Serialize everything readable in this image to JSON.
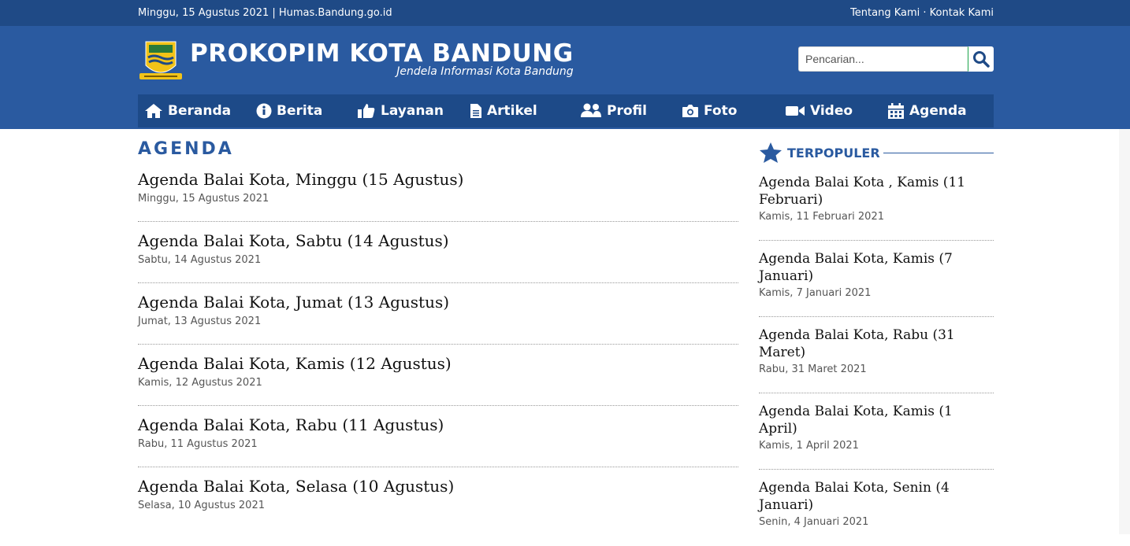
{
  "topbar": {
    "date_site": "Minggu, 15 Agustus 2021 | Humas.Bandung.go.id",
    "links": "Tentang Kami · Kontak Kami"
  },
  "brand": {
    "title": "PROKOPIM KOTA BANDUNG",
    "tagline": "Jendela Informasi Kota Bandung"
  },
  "search": {
    "placeholder": "Pencarian..."
  },
  "nav": [
    {
      "label": "Beranda",
      "icon": "home-icon"
    },
    {
      "label": "Berita",
      "icon": "info-icon"
    },
    {
      "label": "Layanan",
      "icon": "thumbs-up-icon"
    },
    {
      "label": "Artikel",
      "icon": "document-icon"
    },
    {
      "label": "Profil",
      "icon": "users-icon"
    },
    {
      "label": "Foto",
      "icon": "camera-icon"
    },
    {
      "label": "Video",
      "icon": "video-icon"
    },
    {
      "label": "Agenda",
      "icon": "calendar-icon"
    }
  ],
  "main": {
    "title": "AGENDA",
    "posts": [
      {
        "title": "Agenda Balai Kota, Minggu (15 Agustus)",
        "date": "Minggu, 15 Agustus 2021"
      },
      {
        "title": "Agenda Balai Kota, Sabtu (14 Agustus)",
        "date": "Sabtu, 14 Agustus 2021"
      },
      {
        "title": "Agenda Balai Kota, Jumat (13 Agustus)",
        "date": "Jumat, 13 Agustus 2021"
      },
      {
        "title": "Agenda Balai Kota, Kamis (12 Agustus)",
        "date": "Kamis, 12 Agustus 2021"
      },
      {
        "title": "Agenda Balai Kota, Rabu (11 Agustus)",
        "date": "Rabu, 11 Agustus 2021"
      },
      {
        "title": "Agenda Balai Kota, Selasa (10 Agustus)",
        "date": "Selasa, 10 Agustus 2021"
      }
    ]
  },
  "sidebar": {
    "title": "TERPOPULER",
    "icon": "star-icon",
    "items": [
      {
        "title": "Agenda Balai Kota , Kamis (11 Februari)",
        "date": "Kamis, 11 Februari 2021"
      },
      {
        "title": "Agenda Balai Kota, Kamis (7 Januari)",
        "date": "Kamis, 7 Januari 2021"
      },
      {
        "title": "Agenda Balai Kota, Rabu (31 Maret)",
        "date": "Rabu, 31 Maret 2021"
      },
      {
        "title": "Agenda Balai Kota, Kamis (1 April)",
        "date": "Kamis, 1 April 2021"
      },
      {
        "title": "Agenda Balai Kota, Senin (4 Januari)",
        "date": "Senin, 4 Januari 2021"
      }
    ]
  },
  "colors": {
    "topbar": "#1f4a86",
    "header": "#2a5aa0",
    "nav": "#1d4a88",
    "accent": "#2a5aa0"
  }
}
